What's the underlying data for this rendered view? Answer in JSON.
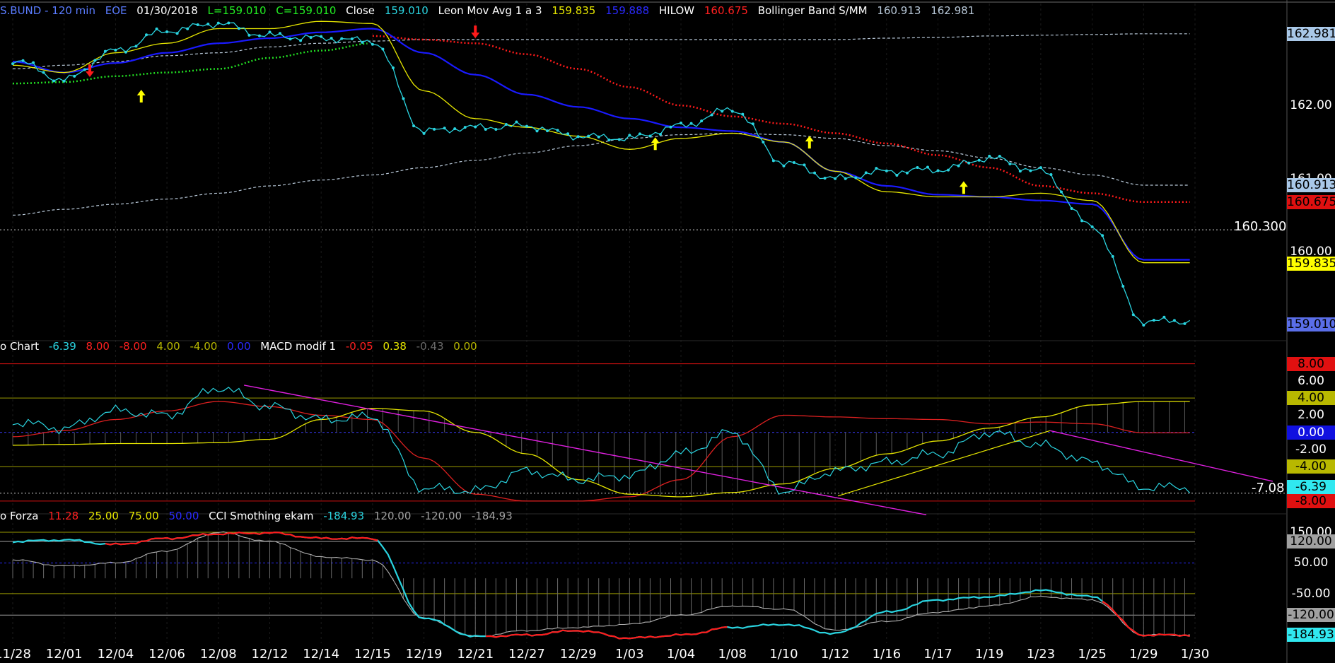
{
  "header1": {
    "symbol": "S.BUND - 120 min",
    "exch": "EOE",
    "date": "01/30/2018",
    "low": "L=159.010",
    "close": "C=159.010",
    "close_lbl": "Close",
    "close_val": "159.010",
    "leon": "Leon Mov Avg 1 a 3",
    "leon_v1": "159.835",
    "leon_v2": "159.888",
    "hilow": "HILOW",
    "hilow_val": "160.675",
    "boll": "Bollinger Band S/MM",
    "boll_v1": "160.913",
    "boll_v2": "162.981"
  },
  "header2": {
    "name": "o Chart",
    "v1": "-6.39",
    "v2": "8.00",
    "v3": "-8.00",
    "v4": "4.00",
    "v5": "-4.00",
    "v6": "0.00",
    "macd": "MACD modif 1",
    "m1": "-0.05",
    "m2": "0.38",
    "m3": "-0.43",
    "m4": "0.00"
  },
  "header3": {
    "name": "o Forza",
    "v1": "11.28",
    "v2": "25.00",
    "v3": "75.00",
    "v4": "50.00",
    "cci": "CCI Smothing ekam",
    "c1": "-184.93",
    "c2": "120.00",
    "c3": "-120.00",
    "c4": "-184.93"
  },
  "colors": {
    "price": "#2ad4e0",
    "avg_yellow": "#e6e600",
    "avg_blue": "#1a1aff",
    "hilow_red": "#ff1a1a",
    "hilow_green": "#22dd22",
    "boll": "#b8c8d8",
    "magenta": "#e020e0",
    "osc_red": "#dd2020",
    "grid": "#1b1b1b"
  },
  "price_axis": {
    "labels": [
      {
        "text": "162.981",
        "value": 162.981,
        "bg": "#a9c8e8",
        "fg": "#000"
      },
      {
        "text": "162.00",
        "value": 162.0,
        "bg": null,
        "fg": "#fff"
      },
      {
        "text": "161.00",
        "value": 161.0,
        "bg": null,
        "fg": "#fff"
      },
      {
        "text": "160.913",
        "value": 160.913,
        "bg": "#a9c8e8",
        "fg": "#000"
      },
      {
        "text": "160.675",
        "value": 160.675,
        "bg": "#e01010",
        "fg": "#000"
      },
      {
        "text": "160.00",
        "value": 160.0,
        "bg": null,
        "fg": "#fff"
      },
      {
        "text": "159.835",
        "value": 159.835,
        "bg": "#ffff00",
        "fg": "#000"
      },
      {
        "text": "159.010",
        "value": 159.01,
        "bg": "#5a6ee8",
        "fg": "#000"
      }
    ],
    "level": "160.300"
  },
  "osc_axis": {
    "labels": [
      {
        "text": "8.00",
        "value": 8,
        "bg": "#e01010",
        "fg": "#000"
      },
      {
        "text": "6.00",
        "value": 6,
        "bg": null,
        "fg": "#fff"
      },
      {
        "text": "4.00",
        "value": 4,
        "bg": "#b8b800",
        "fg": "#000"
      },
      {
        "text": "2.00",
        "value": 2,
        "bg": null,
        "fg": "#fff"
      },
      {
        "text": "0.00",
        "value": 0,
        "bg": "#1010e0",
        "fg": "#fff"
      },
      {
        "text": "-2.00",
        "value": -2,
        "bg": null,
        "fg": "#fff"
      },
      {
        "text": "-4.00",
        "value": -4,
        "bg": "#b8b800",
        "fg": "#000"
      },
      {
        "text": "-6.39",
        "value": -6.39,
        "bg": "#30e8f0",
        "fg": "#000"
      },
      {
        "text": "-8.00",
        "value": -8,
        "bg": "#e01010",
        "fg": "#000"
      }
    ],
    "level": "-7.08"
  },
  "cci_axis": {
    "labels": [
      {
        "text": "150.00",
        "value": 150,
        "bg": null,
        "fg": "#fff"
      },
      {
        "text": "120.00",
        "value": 120,
        "bg": "#a0a0a0",
        "fg": "#000"
      },
      {
        "text": "50.00",
        "value": 50,
        "bg": null,
        "fg": "#fff"
      },
      {
        "text": "-50.00",
        "value": -50,
        "bg": null,
        "fg": "#fff"
      },
      {
        "text": "-120.00",
        "value": -120,
        "bg": "#a0a0a0",
        "fg": "#000"
      },
      {
        "text": "-184.93",
        "value": -184.93,
        "bg": "#30e8f0",
        "fg": "#000"
      }
    ]
  },
  "chart_data": {
    "type": "line",
    "title": "S.BUND - 120 min",
    "dates": [
      "11/28",
      "12/01",
      "12/04",
      "12/06",
      "12/08",
      "12/12",
      "12/14",
      "12/15",
      "12/19",
      "12/21",
      "12/27",
      "12/29",
      "1/03",
      "1/04",
      "1/08",
      "1/10",
      "1/12",
      "1/16",
      "1/17",
      "1/19",
      "1/23",
      "1/25",
      "1/29",
      "1/30"
    ],
    "price_panel": {
      "ylim": [
        158.9,
        163.2
      ],
      "close": [
        162.62,
        162.35,
        162.75,
        163.02,
        163.12,
        162.95,
        162.92,
        162.88,
        161.65,
        161.7,
        161.72,
        161.58,
        161.55,
        161.72,
        161.95,
        161.22,
        161.0,
        161.1,
        161.12,
        161.28,
        161.1,
        160.35,
        159.05,
        159.05
      ],
      "mov_avg_yellow": [
        162.55,
        162.45,
        162.72,
        162.85,
        163.05,
        163.05,
        163.15,
        163.12,
        162.2,
        161.82,
        161.7,
        161.58,
        161.4,
        161.55,
        161.62,
        161.5,
        161.1,
        160.82,
        160.75,
        160.75,
        160.8,
        160.7,
        159.85,
        159.85
      ],
      "mov_avg_blue": [
        162.6,
        162.45,
        162.58,
        162.72,
        162.85,
        162.92,
        163.0,
        163.05,
        162.72,
        162.42,
        162.15,
        161.98,
        161.82,
        161.7,
        161.65,
        161.5,
        161.1,
        160.9,
        160.78,
        160.75,
        160.7,
        160.65,
        159.89,
        159.89
      ],
      "hilow_red": [
        162.45,
        null,
        null,
        null,
        null,
        null,
        null,
        162.95,
        162.9,
        162.85,
        162.7,
        162.5,
        162.25,
        162.0,
        161.85,
        161.75,
        161.62,
        161.48,
        161.32,
        161.15,
        160.9,
        160.8,
        160.68,
        160.68
      ],
      "hilow_green": [
        162.3,
        162.32,
        162.4,
        162.45,
        162.5,
        162.65,
        162.75,
        162.85,
        null,
        null,
        null,
        null,
        null,
        null,
        null,
        null,
        null,
        null,
        null,
        null,
        null,
        null,
        null,
        null
      ],
      "boll_upper": [
        162.5,
        162.55,
        162.6,
        162.68,
        162.72,
        162.8,
        162.85,
        162.88,
        162.9,
        162.9,
        162.9,
        162.9,
        162.9,
        162.9,
        162.9,
        162.9,
        162.9,
        162.92,
        162.93,
        162.95,
        162.96,
        162.97,
        162.98,
        162.98
      ],
      "boll_lower": [
        160.5,
        160.58,
        160.65,
        160.72,
        160.8,
        160.9,
        160.98,
        161.05,
        161.15,
        161.25,
        161.35,
        161.45,
        161.55,
        161.6,
        161.62,
        161.6,
        161.55,
        161.45,
        161.38,
        161.28,
        161.15,
        161.05,
        160.91,
        160.91
      ],
      "level": 160.3
    },
    "osc_panel": {
      "ylim": [
        -8.5,
        9.2
      ],
      "cyan": [
        1.2,
        0.5,
        2.5,
        2.0,
        5.2,
        3.0,
        1.5,
        1.8,
        -6.5,
        -6.8,
        -4.5,
        -5.5,
        -5.0,
        -2.5,
        0.0,
        -6.8,
        -4.5,
        -3.5,
        -2.5,
        0.0,
        -1.5,
        -3.5,
        -6.39,
        -6.39
      ],
      "red": [
        -0.5,
        0.2,
        1.5,
        2.5,
        3.6,
        3.0,
        2.0,
        1.5,
        -3.0,
        -7.2,
        -8.0,
        -8.0,
        -7.5,
        -5.5,
        -0.5,
        2.0,
        1.8,
        1.6,
        1.5,
        1.0,
        1.2,
        1.0,
        -0.05,
        -0.05
      ],
      "yellow": [
        -1.5,
        -1.4,
        -1.3,
        -1.3,
        -1.2,
        -0.8,
        1.5,
        2.8,
        2.5,
        0.0,
        -2.5,
        -5.5,
        -7.2,
        -7.5,
        -7.0,
        -6.0,
        -4.2,
        -2.5,
        -1.0,
        0.5,
        1.8,
        3.2,
        3.6,
        3.6
      ],
      "level": -7.08
    },
    "cci_panel": {
      "ylim": [
        -200,
        180
      ],
      "cci": [
        120,
        125,
        110,
        130,
        145,
        148,
        130,
        130,
        -130,
        -190,
        -185,
        -170,
        -195,
        -185,
        -160,
        -150,
        -180,
        -110,
        -70,
        -60,
        -40,
        -60,
        -184.93,
        -184.93
      ],
      "grey": [
        60,
        40,
        50,
        90,
        150,
        120,
        70,
        60,
        -130,
        -190,
        -170,
        -160,
        -150,
        -120,
        -90,
        -100,
        -170,
        -140,
        -110,
        -90,
        -60,
        -70,
        -184.93,
        -184.93
      ]
    }
  }
}
